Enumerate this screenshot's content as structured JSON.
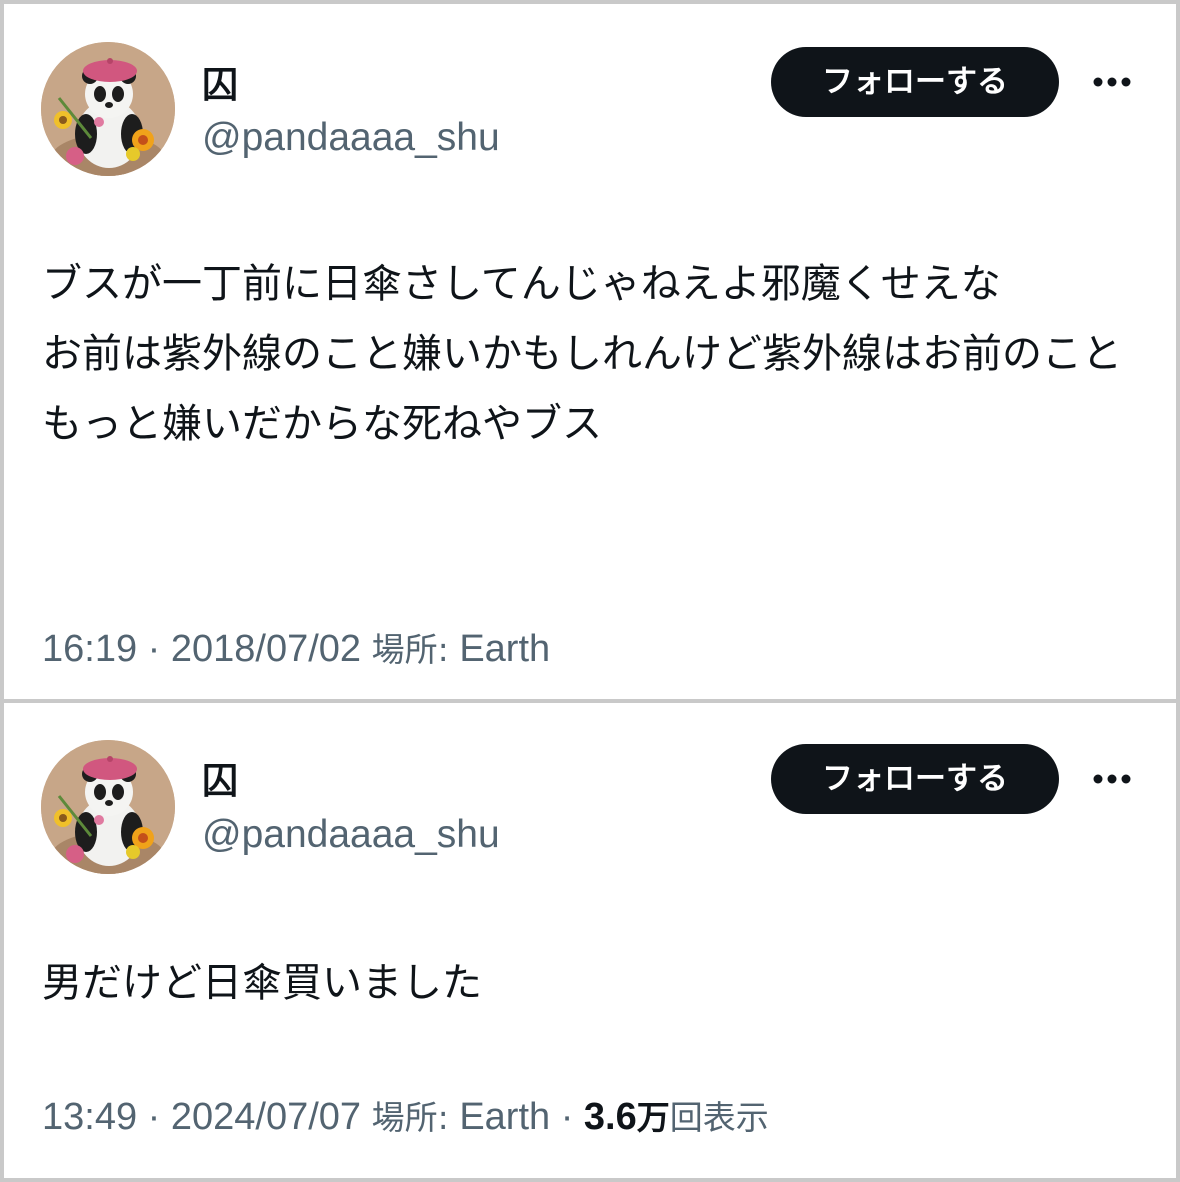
{
  "tweets": [
    {
      "author": {
        "display_name": "囚",
        "handle": "@pandaaaa_shu",
        "avatar": "panda-with-pink-beret-and-flowers"
      },
      "follow_label": "フォローする",
      "more_icon": "more-horizontal-icon",
      "text": "ブスが一丁前に日傘さしてんじゃねえよ邪魔くせえな\nお前は紫外線のこと嫌いかもしれんけど紫外線はお前のこともっと嫌いだからな死ねやブス",
      "time": "16:19",
      "separator": "·",
      "date": "2018/07/02",
      "location_label": "場所:",
      "location": "Earth"
    },
    {
      "author": {
        "display_name": "囚",
        "handle": "@pandaaaa_shu",
        "avatar": "panda-with-pink-beret-and-flowers"
      },
      "follow_label": "フォローする",
      "more_icon": "more-horizontal-icon",
      "text": "男だけど日傘買いました",
      "time": "13:49",
      "separator": "·",
      "date": "2024/07/07",
      "location_label": "場所:",
      "location": "Earth",
      "views_count": "3.6",
      "views_unit": "万",
      "views_label": "回表示"
    }
  ],
  "colors": {
    "text_primary": "#0f1419",
    "text_secondary": "#536471",
    "button_bg": "#0f1419",
    "button_text": "#ffffff",
    "border": "#c9c9c9"
  }
}
